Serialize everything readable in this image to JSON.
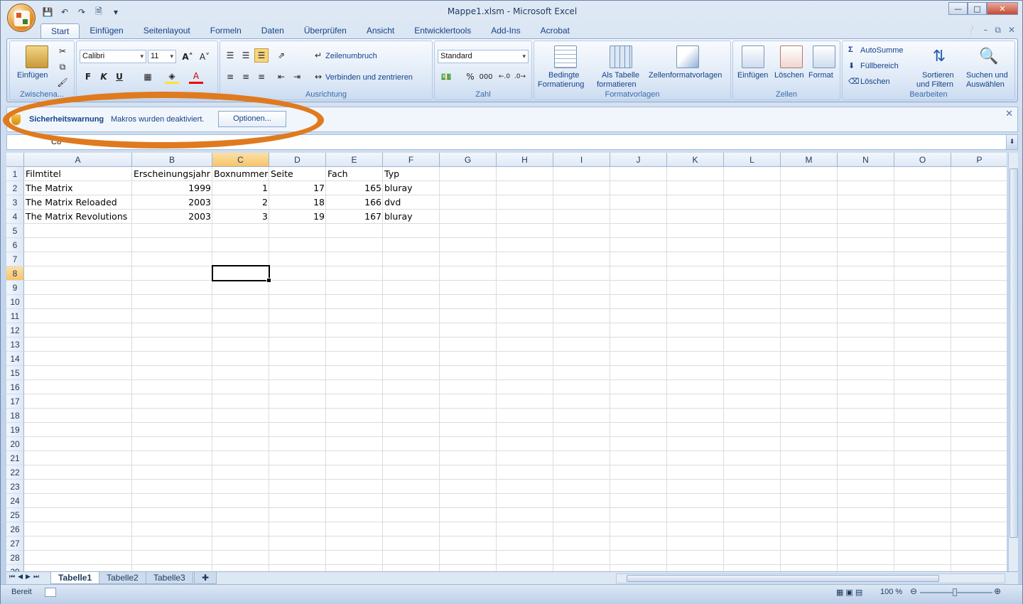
{
  "window": {
    "title": "Mappe1.xlsm - Microsoft Excel"
  },
  "tabs": [
    "Start",
    "Einfügen",
    "Seitenlayout",
    "Formeln",
    "Daten",
    "Überprüfen",
    "Ansicht",
    "Entwicklertools",
    "Add-Ins",
    "Acrobat"
  ],
  "ribbon": {
    "clipboard": {
      "paste": "Einfügen",
      "label": "Zwischena..."
    },
    "font": {
      "name": "Calibri",
      "size": "11",
      "bold": "F",
      "italic": "K",
      "underline": "U"
    },
    "alignment": {
      "wrap": "Zeilenumbruch",
      "merge": "Verbinden und zentrieren",
      "label": "Ausrichtung"
    },
    "number": {
      "format": "Standard",
      "percent": "%",
      "thousands": "000",
      "label": "Zahl"
    },
    "styles": {
      "conditional": [
        "Bedingte",
        "Formatierung"
      ],
      "table": [
        "Als Tabelle",
        "formatieren"
      ],
      "cellstyles": "Zellenformatvorlagen",
      "label": "Formatvorlagen"
    },
    "cells": {
      "insert": "Einfügen",
      "delete": "Löschen",
      "format": "Format",
      "label": "Zellen"
    },
    "editing": {
      "autosum": "AutoSumme",
      "fill": "Füllbereich",
      "clear": "Löschen",
      "sort": [
        "Sortieren",
        "und Filtern"
      ],
      "find": [
        "Suchen und",
        "Auswählen"
      ],
      "label": "Bearbeiten"
    }
  },
  "security": {
    "title": "Sicherheitswarnung",
    "message": "Makros wurden deaktiviert.",
    "options_button": "Optionen..."
  },
  "formula_bar": {
    "name_box": "C8"
  },
  "sheet": {
    "columns": [
      "A",
      "B",
      "C",
      "D",
      "E",
      "F",
      "G",
      "H",
      "I",
      "J",
      "K",
      "L",
      "M",
      "N",
      "O",
      "P"
    ],
    "selected_column": "C",
    "selected_row": 8,
    "rows": [
      [
        "Filmtitel",
        "Erscheinungsjahr",
        "Boxnummer",
        "Seite",
        "Fach",
        "Typ"
      ],
      [
        "The Matrix",
        "1999",
        "1",
        "17",
        "165",
        "bluray"
      ],
      [
        "The Matrix Reloaded",
        "2003",
        "2",
        "18",
        "166",
        "dvd"
      ],
      [
        "The Matrix Revolutions",
        "2003",
        "3",
        "19",
        "167",
        "bluray"
      ]
    ],
    "row_count": 28
  },
  "sheet_tabs": [
    "Tabelle1",
    "Tabelle2",
    "Tabelle3"
  ],
  "status": {
    "ready": "Bereit",
    "zoom": "100 %"
  },
  "colors": {
    "accent": "#e07a1e",
    "ribbon_text": "#15428b"
  }
}
